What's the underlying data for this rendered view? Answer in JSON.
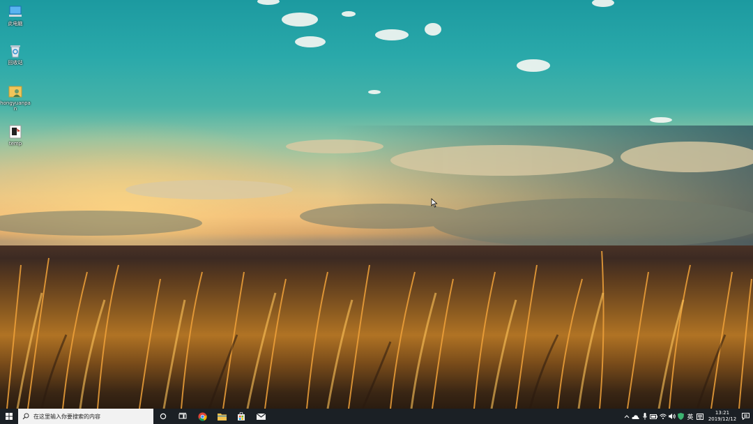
{
  "desktop": {
    "icons": [
      {
        "label": "此电脑",
        "icon": "this-pc-icon"
      },
      {
        "label": "回收站",
        "icon": "recycle-bin-icon"
      },
      {
        "label": "hongyuanpan",
        "icon": "user-folder-icon"
      },
      {
        "label": "temp",
        "icon": "temp-shortcut-icon"
      }
    ]
  },
  "taskbar": {
    "search_placeholder": "在这里输入你要搜索的内容",
    "pinned": [
      "cortana-icon",
      "task-view-icon",
      "chrome-icon",
      "file-explorer-icon",
      "store-icon",
      "mail-icon"
    ],
    "tray": {
      "ime_label": "英",
      "time": "13:21",
      "date": "2019/12/12"
    },
    "colors": {
      "background": "#1b2025",
      "search_bg": "#f2f2f2",
      "accent": "#0078d7"
    }
  }
}
